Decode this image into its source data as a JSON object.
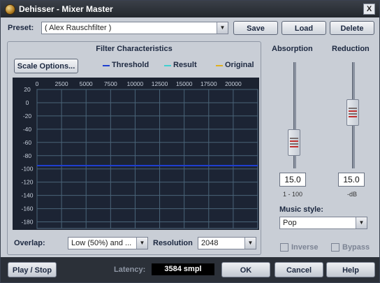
{
  "window": {
    "title": "Dehisser - Mixer Master",
    "close_label": "X"
  },
  "preset": {
    "label": "Preset:",
    "value": "( Alex Rauschfilter )",
    "save": "Save",
    "load": "Load",
    "delete": "Delete"
  },
  "filter": {
    "title": "Filter Characteristics",
    "scale_options": "Scale Options...",
    "legend": [
      {
        "label": "Threshold",
        "color": "#1f3fd0"
      },
      {
        "label": "Result",
        "color": "#40d0d0"
      },
      {
        "label": "Original",
        "color": "#e0b020"
      }
    ]
  },
  "chart_data": {
    "type": "line",
    "x_ticks": [
      "0",
      "2500",
      "5000",
      "7500",
      "10000",
      "12500",
      "15000",
      "17500",
      "20000"
    ],
    "y_ticks": [
      "20",
      "0",
      "-20",
      "-40",
      "-60",
      "-80",
      "-100",
      "-120",
      "-140",
      "-160",
      "-180"
    ],
    "xlim": [
      0,
      22500
    ],
    "ylim": [
      -190,
      20
    ],
    "series": [
      {
        "name": "Threshold",
        "x": [
          0,
          22500
        ],
        "y": [
          -95,
          -95
        ],
        "color": "#1f3fd0"
      }
    ],
    "grid": true
  },
  "overlap": {
    "label": "Overlap:",
    "value": "Low (50%) and ..."
  },
  "resolution": {
    "label": "Resolution",
    "value": "2048"
  },
  "absorption": {
    "label": "Absorption",
    "value": "15.0",
    "range": "1 - 100",
    "level": 0.15
  },
  "reduction": {
    "label": "Reduction",
    "value": "15.0",
    "unit": "-dB",
    "level": 0.5
  },
  "music_style": {
    "label": "Music style:",
    "value": "Pop"
  },
  "options": {
    "inverse": "Inverse",
    "bypass": "Bypass"
  },
  "bottom": {
    "play_stop": "Play / Stop",
    "latency_label": "Latency:",
    "latency_value": "3584 smpl",
    "ok": "OK",
    "cancel": "Cancel",
    "help": "Help"
  },
  "icons": {
    "app": "app-icon",
    "dropdown": "chevron-down-icon"
  }
}
